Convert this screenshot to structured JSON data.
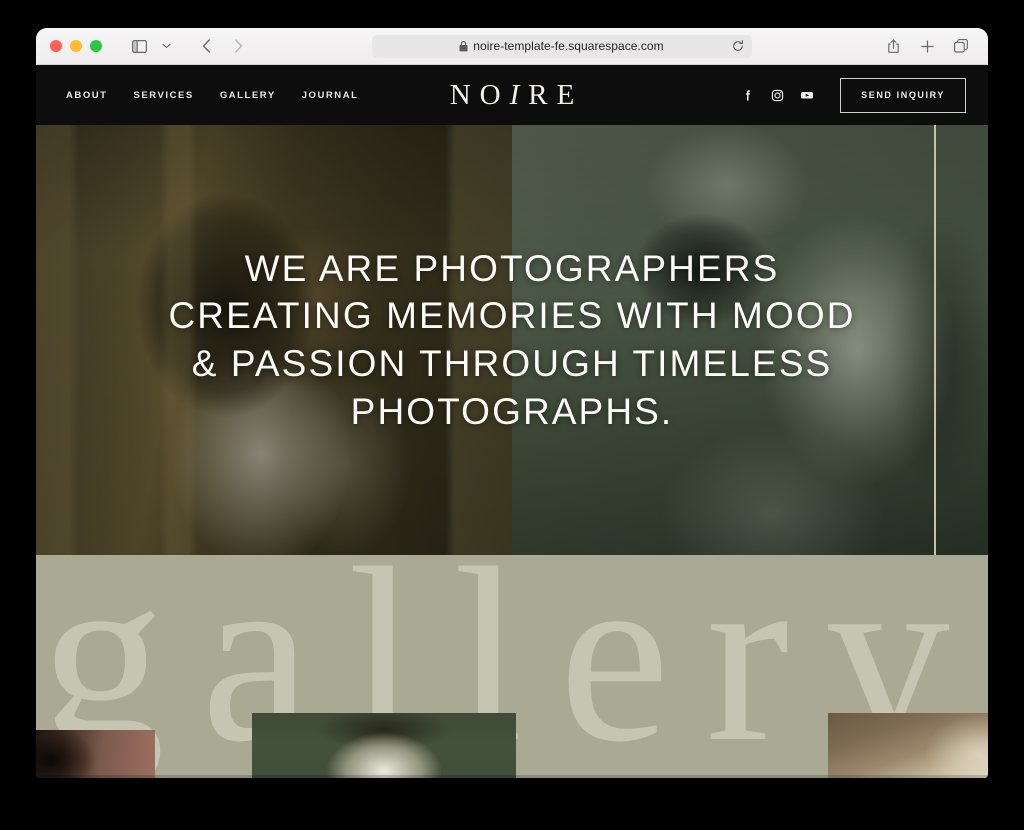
{
  "browser": {
    "traffic_lights": [
      "close",
      "minimize",
      "zoom"
    ],
    "sidebar_label": "Sidebar",
    "tab_overview_label": "Tab Overview",
    "back_label": "Back",
    "forward_label": "Forward",
    "url": "noire-template-fe.squarespace.com",
    "lock_icon": "lock-icon",
    "reload_icon": "reload-icon",
    "share_icon": "share-icon",
    "new_tab_icon": "plus-icon",
    "tabs_icon": "tabs-icon"
  },
  "site": {
    "brand": {
      "part1": "NO",
      "part_italic": "I",
      "part2": "RE",
      "full": "NOIRE"
    },
    "nav": [
      {
        "label": "ABOUT"
      },
      {
        "label": "SERVICES"
      },
      {
        "label": "GALLERY"
      },
      {
        "label": "JOURNAL"
      }
    ],
    "social": [
      {
        "name": "facebook-icon",
        "label": "Facebook"
      },
      {
        "name": "instagram-icon",
        "label": "Instagram"
      },
      {
        "name": "youtube-icon",
        "label": "YouTube"
      }
    ],
    "cta": {
      "label": "SEND INQUIRY"
    },
    "hero": {
      "headline": "WE ARE PHOTOGRAPHERS CREATING MEMORIES WITH MOOD & PASSION THROUGH TIMELESS PHOTOGRAPHS.",
      "left_image_alt": "Two women seated in warm-toned interior",
      "right_image_alt": "Woman holding a film camera to her face"
    },
    "gallery": {
      "watermark": "gallery",
      "thumbnails": [
        {
          "alt": "Dark portrait detail"
        },
        {
          "alt": "Portrait on deep green background"
        },
        {
          "alt": "Warm sunlit interior detail"
        }
      ]
    },
    "colors": {
      "header_bg": "#0d0d0d",
      "text_light": "#f1f0eb",
      "gallery_bg": "#a9a994",
      "gallery_watermark": "#c6c5b1",
      "hero_rule": "#c7c2a9"
    }
  }
}
